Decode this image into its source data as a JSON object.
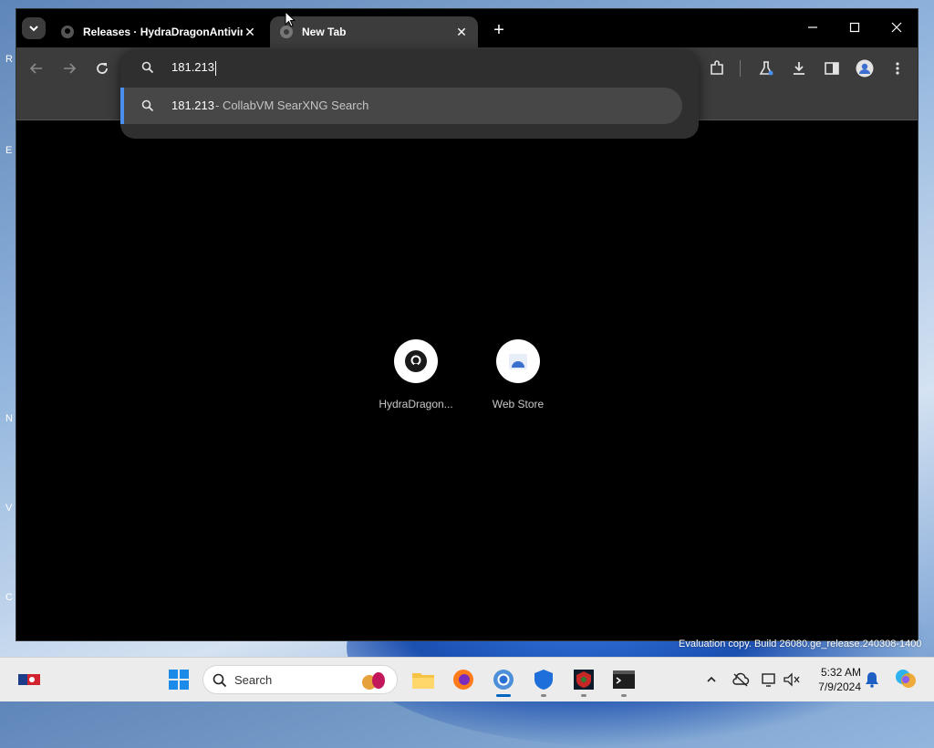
{
  "browser": {
    "tabs": [
      {
        "title": "Releases · HydraDragonAntivir",
        "active": false,
        "favicon": "github-icon"
      },
      {
        "title": "New Tab",
        "active": true,
        "favicon": "chrome-icon"
      }
    ],
    "new_tab_symbol": "+",
    "tab_close_symbol": "✕"
  },
  "omnibox": {
    "input_value": "181.213",
    "suggestion": {
      "query": "181.213",
      "provider": "- CollabVM SearXNG Search"
    }
  },
  "shortcuts": [
    {
      "label": "HydraDragon...",
      "icon": "github-icon"
    },
    {
      "label": "Web Store",
      "icon": "web-store-icon"
    }
  ],
  "watermark": "Evaluation copy. Build 26080.ge_release.240308-1400",
  "taskbar": {
    "search_label": "Search",
    "time": "5:32 AM",
    "date": "7/9/2024"
  },
  "colors": {
    "accent": "#4a8ff0",
    "tab_active_bg": "#3c3c3c",
    "taskbar_bg": "#ececec"
  }
}
